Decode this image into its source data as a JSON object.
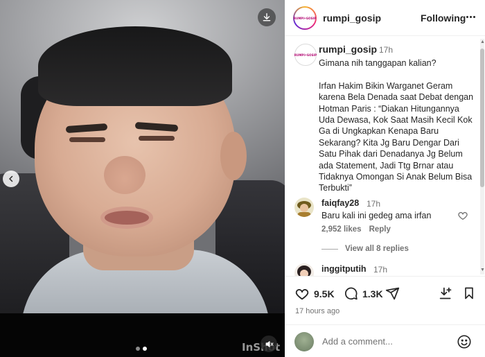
{
  "media": {
    "watermark": "InShot",
    "carousel": {
      "count": 2,
      "active_index": 1
    },
    "icons": {
      "download": "download-icon",
      "previous": "chevron-left-icon",
      "mute": "speaker-muted-icon"
    }
  },
  "header": {
    "username": "rumpi_gosip",
    "avatar_text": "RUMPI•GOSIP",
    "follow_label": "Following",
    "more_icon": "more-horizontal-icon"
  },
  "caption": {
    "username": "rumpi_gosip",
    "time": "17h",
    "text": "Gimana nih tanggapan kalian?\n\nIrfan Hakim Bikin Warganet Geram karena Bela Denada saat Debat dengan Hotman Paris : “Diakan Hitungannya Uda Dewasa, Kok Saat Masih Kecil Kok Ga di Ungkapkan Kenapa Baru Sekarang? Kita Jg Baru Dengar Dari Satu Pihak dari Denadanya Jg Belum ada Statement, Jadi Ttg Brnar atau Tidaknya Omongan Si Anak Belum Bisa Terbukti”"
  },
  "comments": [
    {
      "username": "faiqfay28",
      "time": "17h",
      "text": "Baru kali ini gedeg ama irfan",
      "likes": "2,952 likes",
      "reply_label": "Reply",
      "view_replies": "View all 8 replies"
    },
    {
      "username": "inggitputih",
      "time": "17h"
    }
  ],
  "actions": {
    "like_count": "9.5K",
    "comment_count": "1.3K",
    "time_ago": "17 hours ago"
  },
  "add_comment": {
    "placeholder": "Add a comment..."
  },
  "colors": {
    "text": "#262626",
    "muted": "#737373",
    "divider": "#efefef"
  }
}
